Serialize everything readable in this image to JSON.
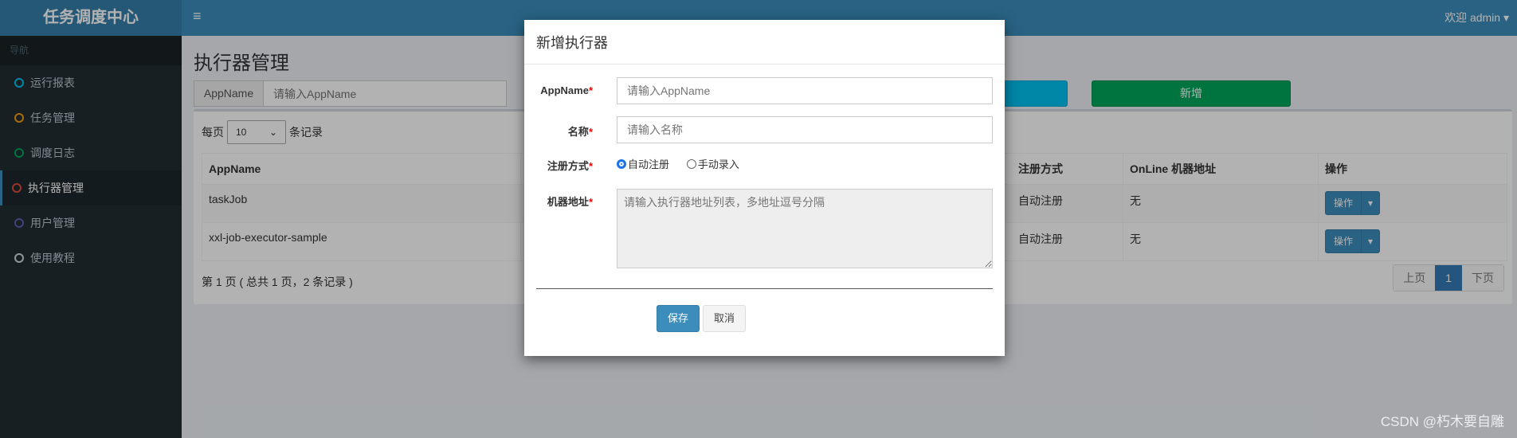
{
  "header": {
    "logo": "任务调度中心",
    "menu_icon": "≡",
    "user": "欢迎 admin ▾"
  },
  "sidebar": {
    "nav_label": "导航",
    "items": [
      {
        "label": "运行报表",
        "color": "#00c0ef"
      },
      {
        "label": "任务管理",
        "color": "#f39c12"
      },
      {
        "label": "调度日志",
        "color": "#00a65a"
      },
      {
        "label": "执行器管理",
        "color": "#dd4b39",
        "active": true
      },
      {
        "label": "用户管理",
        "color": "#605ca8"
      },
      {
        "label": "使用教程",
        "color": "#d2d6de"
      }
    ]
  },
  "main": {
    "title": "执行器管理",
    "search": {
      "addon": "AppName",
      "placeholder": "请输入AppName"
    },
    "add_button": "新增",
    "length": {
      "prefix": "每页",
      "value": "10",
      "suffix": "条记录"
    },
    "table": {
      "headers": [
        "AppName",
        "",
        "",
        "注册方式",
        "OnLine 机器地址",
        "操作"
      ],
      "rows": [
        {
          "appname": "taskJob",
          "reg": "自动注册",
          "online": "无",
          "action": "操作"
        },
        {
          "appname": "xxl-job-executor-sample",
          "reg": "自动注册",
          "online": "无",
          "action": "操作"
        }
      ]
    },
    "info": "第 1 页 ( 总共 1 页，2 条记录 )",
    "pagination": {
      "prev": "上页",
      "current": "1",
      "next": "下页"
    }
  },
  "modal": {
    "title": "新增执行器",
    "appname_label": "AppName",
    "appname_placeholder": "请输入AppName",
    "name_label": "名称",
    "name_placeholder": "请输入名称",
    "reg_label": "注册方式",
    "reg_options": [
      "自动注册",
      "手动录入"
    ],
    "reg_selected": "自动注册",
    "addr_label": "机器地址",
    "addr_placeholder": "请输入执行器地址列表，多地址逗号分隔",
    "required_mark": "*",
    "save": "保存",
    "cancel": "取消"
  },
  "watermark": "CSDN @朽木要自雕"
}
